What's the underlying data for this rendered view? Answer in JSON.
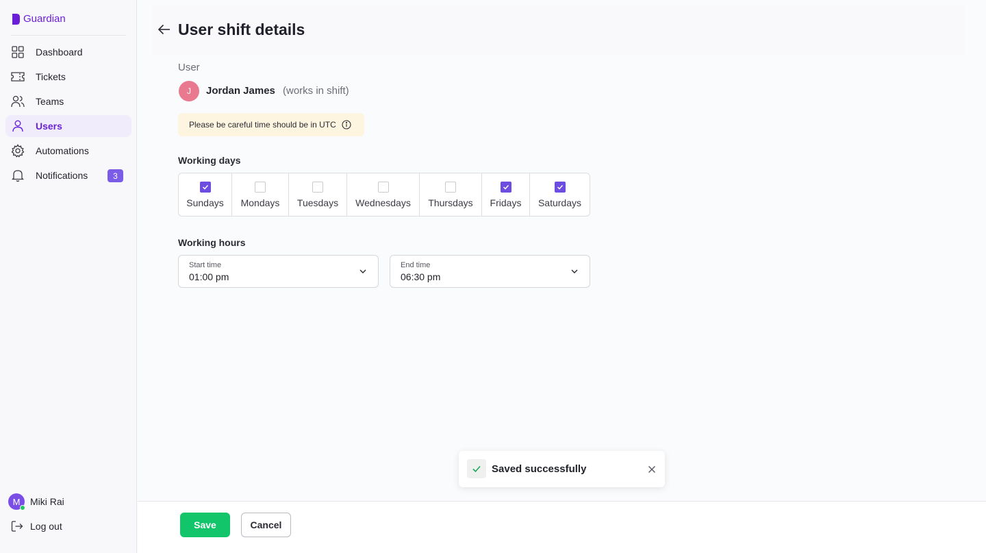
{
  "brand": {
    "name": "Guardian",
    "color": "#6a1ed8"
  },
  "sidebar": {
    "items": [
      {
        "label": "Dashboard",
        "icon": "grid-icon",
        "active": false
      },
      {
        "label": "Tickets",
        "icon": "ticket-icon",
        "active": false
      },
      {
        "label": "Teams",
        "icon": "team-icon",
        "active": false
      },
      {
        "label": "Users",
        "icon": "user-icon",
        "active": true
      },
      {
        "label": "Automations",
        "icon": "gear-icon",
        "active": false
      },
      {
        "label": "Notifications",
        "icon": "bell-icon",
        "active": false,
        "badge": "3"
      }
    ],
    "current_user": {
      "initial": "M",
      "name": "Miki Rai",
      "status": "online"
    },
    "logout_label": "Log out"
  },
  "page": {
    "title": "User shift details",
    "user_section_label": "User",
    "user": {
      "initial": "J",
      "name": "Jordan James",
      "note": "(works in shift)"
    },
    "warning": "Please be careful time should be in UTC",
    "working_days_label": "Working days",
    "days": [
      {
        "label": "Sundays",
        "checked": true
      },
      {
        "label": "Mondays",
        "checked": false
      },
      {
        "label": "Tuesdays",
        "checked": false
      },
      {
        "label": "Wednesdays",
        "checked": false
      },
      {
        "label": "Thursdays",
        "checked": false
      },
      {
        "label": "Fridays",
        "checked": true
      },
      {
        "label": "Saturdays",
        "checked": true
      }
    ],
    "working_hours_label": "Working hours",
    "start_time": {
      "caption": "Start time",
      "value": "01:00 pm"
    },
    "end_time": {
      "caption": "End time",
      "value": "06:30 pm"
    }
  },
  "toast": {
    "message": "Saved successfully"
  },
  "footer": {
    "save_label": "Save",
    "cancel_label": "Cancel"
  },
  "colors": {
    "accent": "#6d4ce0",
    "success": "#12c56a",
    "warning_bg": "#fdf5df"
  }
}
